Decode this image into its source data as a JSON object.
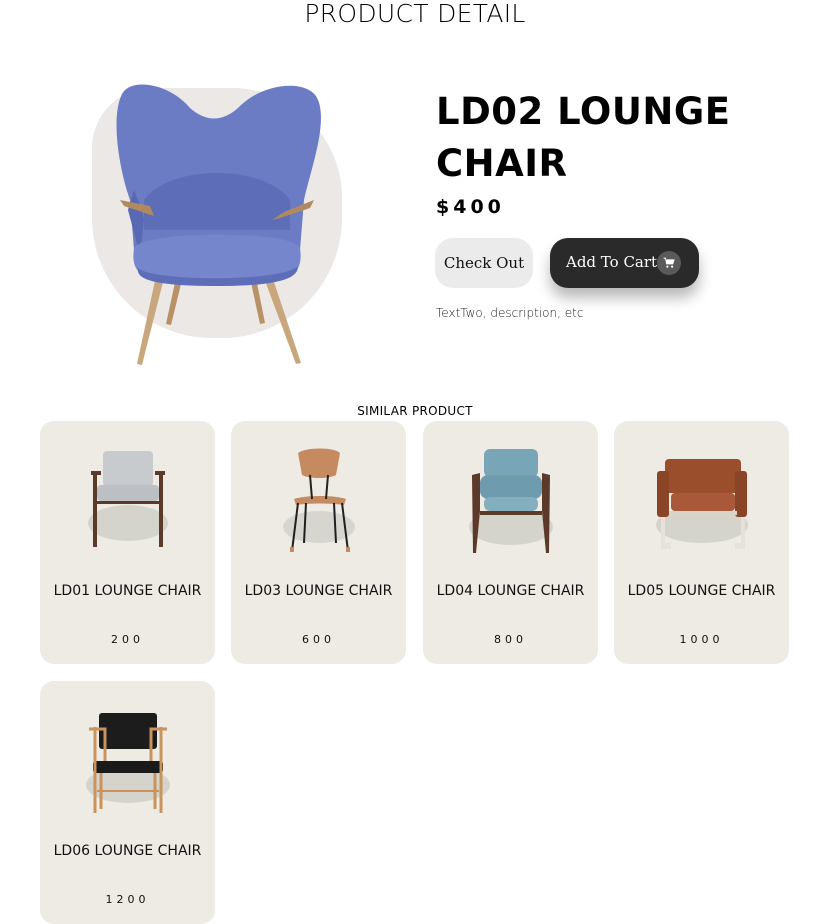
{
  "page": {
    "title": "PRODUCT DETAIL"
  },
  "product": {
    "name": "LD02 LOUNGE CHAIR",
    "price": "$400",
    "description": "TextTwo, description, etc",
    "image_icon": "blue-wingback-lounge-chair"
  },
  "actions": {
    "checkout_label": "Check Out",
    "add_to_cart_label": "Add To Cart",
    "cart_icon": "shopping-cart-icon"
  },
  "similar": {
    "title": "SIMILAR PRODUCT",
    "items": [
      {
        "name": "LD01 LOUNGE CHAIR",
        "price": "200",
        "icon": "grey-upholstered-armchair"
      },
      {
        "name": "LD03 LOUNGE CHAIR",
        "price": "600",
        "icon": "wood-shell-chair"
      },
      {
        "name": "LD04 LOUNGE CHAIR",
        "price": "800",
        "icon": "teal-lounge-armchair"
      },
      {
        "name": "LD05 LOUNGE CHAIR",
        "price": "1000",
        "icon": "brown-leather-armchair"
      },
      {
        "name": "LD06 LOUNGE CHAIR",
        "price": "1200",
        "icon": "black-oak-armchair"
      }
    ]
  },
  "colors": {
    "hero_chair": "#6b7cc4",
    "hero_blob": "#ebe8e6",
    "card_bg": "#edebe4",
    "cart_button": "#2a2a2a",
    "checkout_button": "#ebebeb"
  }
}
